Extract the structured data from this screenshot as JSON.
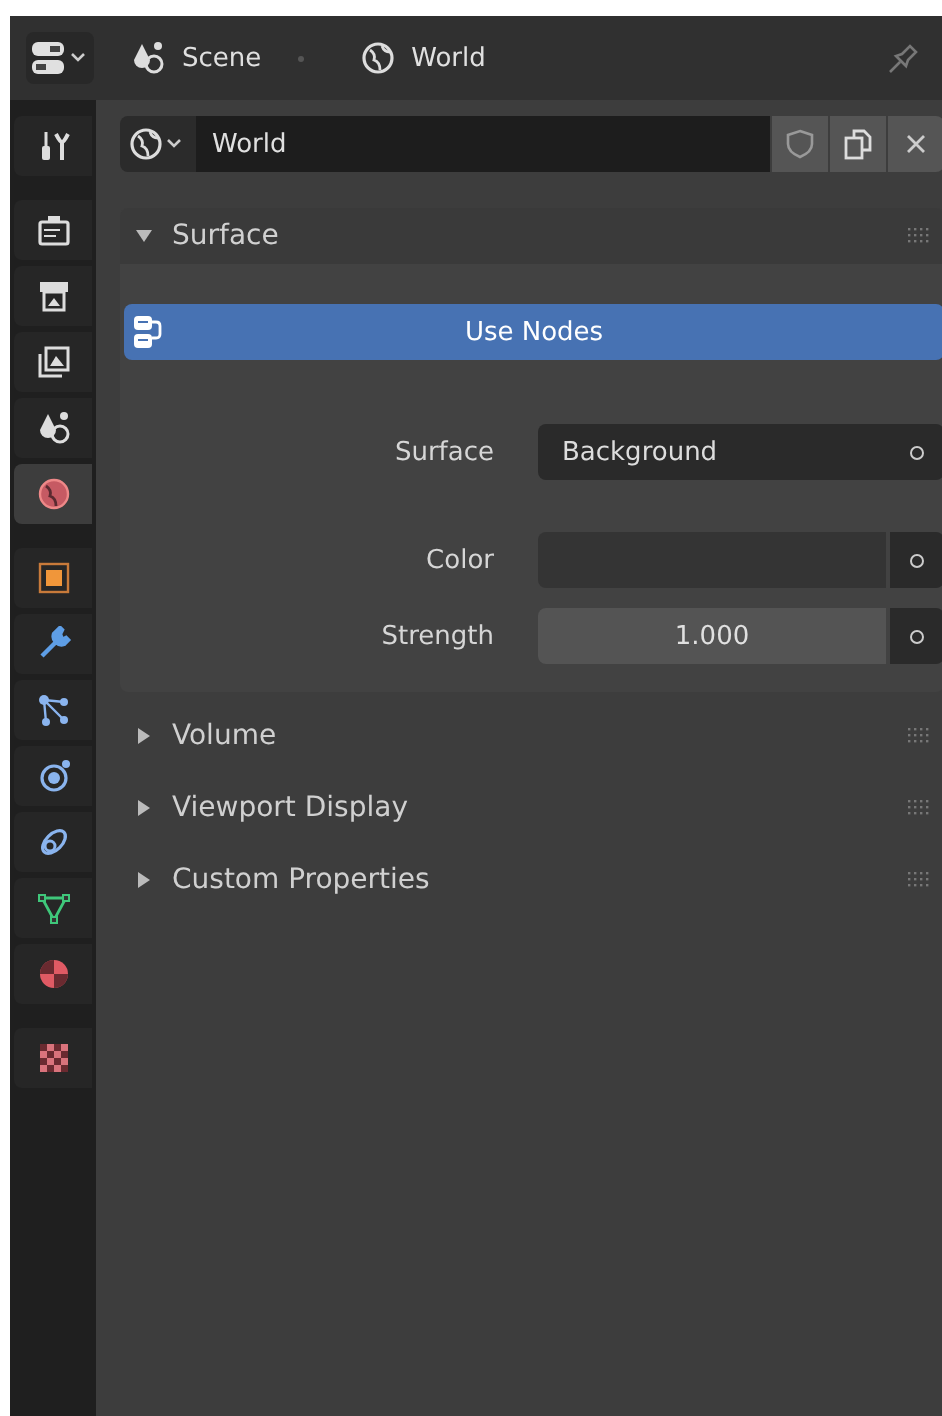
{
  "header": {
    "breadcrumbs": [
      {
        "label": "Scene"
      },
      {
        "label": "World"
      }
    ]
  },
  "sidebar": {
    "groups": [
      {
        "tabs": [
          {
            "selected": false
          }
        ]
      },
      {
        "tabs": [
          {
            "selected": false
          },
          {
            "selected": false
          },
          {
            "selected": false
          },
          {
            "selected": false
          },
          {
            "selected": true
          }
        ]
      },
      {
        "tabs": [
          {
            "selected": false
          },
          {
            "selected": false
          },
          {
            "selected": false
          },
          {
            "selected": false
          },
          {
            "selected": false
          },
          {
            "selected": false
          },
          {
            "selected": false
          }
        ]
      },
      {
        "tabs": [
          {
            "selected": false
          }
        ]
      }
    ]
  },
  "datablock": {
    "value": "World"
  },
  "panels": [
    {
      "title": "Surface",
      "expanded": true,
      "use_nodes": {
        "label": "Use Nodes"
      },
      "properties": [
        {
          "kind": "dropdown",
          "label": "Surface",
          "value": "Background"
        },
        {
          "kind": "color",
          "label": "Color",
          "color": "#343434"
        },
        {
          "kind": "number",
          "label": "Strength",
          "value": "1.000"
        }
      ]
    },
    {
      "title": "Volume",
      "expanded": false
    },
    {
      "title": "Viewport Display",
      "expanded": false
    },
    {
      "title": "Custom Properties",
      "expanded": false
    }
  ]
}
